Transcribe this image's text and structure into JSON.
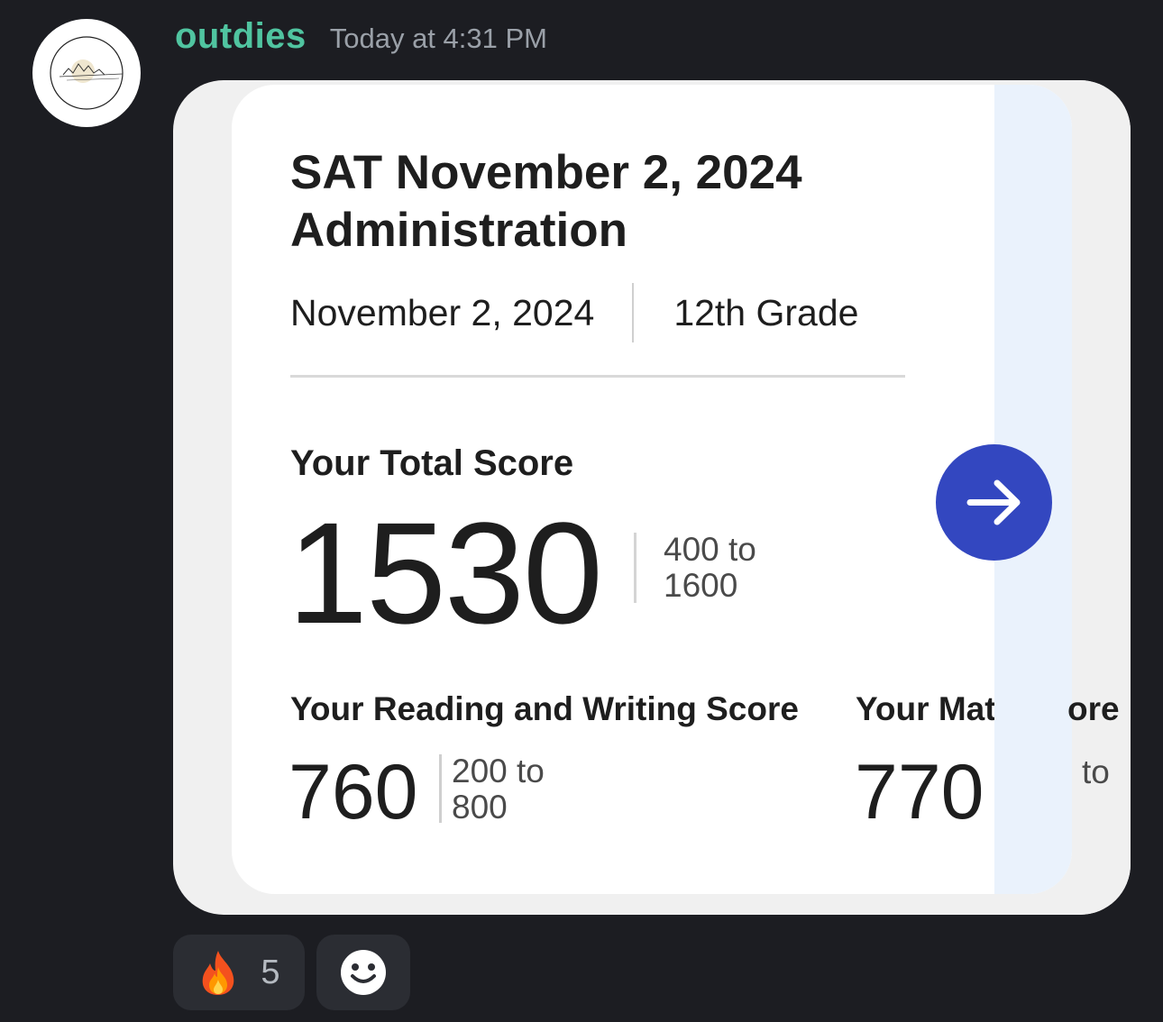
{
  "author": {
    "username": "outdies",
    "timestamp": "Today at 4:31 PM",
    "avatar_icon": "mountain-sketch-icon",
    "username_color": "#50c4a0"
  },
  "score_card": {
    "title": "SAT November 2, 2024 Administration",
    "date": "November 2, 2024",
    "grade": "12th Grade",
    "total": {
      "label": "Your Total Score",
      "value": "1530",
      "range": "400 to 1600"
    },
    "reading_writing": {
      "label": "Your Reading and Writing Score",
      "value": "760",
      "range": "200 to 800"
    },
    "math": {
      "label": "Your Mat",
      "value": "770"
    },
    "next_card_peek": {
      "label_fragment": "ore",
      "range_fragment": "to"
    },
    "next_button_icon": "arrow-right-icon",
    "accent_color": "#3347c0"
  },
  "reactions": [
    {
      "emoji_icon": "fire-icon",
      "count": "5"
    }
  ],
  "add_reaction_icon": "smiley-add-reaction-icon"
}
